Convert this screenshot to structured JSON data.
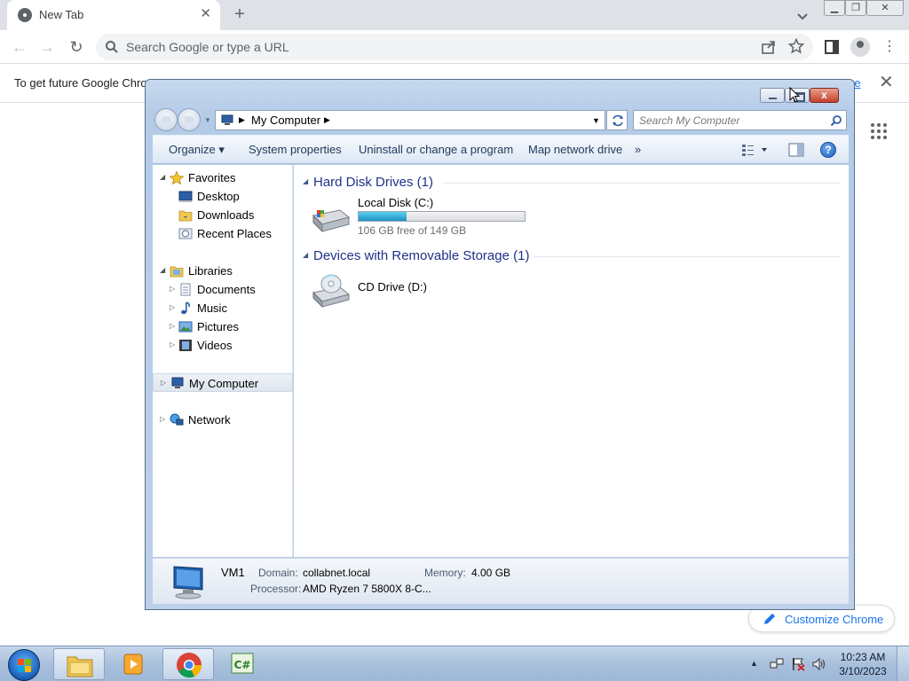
{
  "chrome": {
    "tab_title": "New Tab",
    "tab_close": "✕",
    "new_tab": "+",
    "omnibox_placeholder": "Search Google or type a URL",
    "infobar_text": "To get future Google Chrome updates",
    "infobar_link": "re",
    "infobar_close": "✕",
    "customize_label": "Customize Chrome",
    "accent_color": "#1a73e8"
  },
  "explorer": {
    "breadcrumb": "My Computer",
    "search_placeholder": "Search My Computer",
    "close_glyph": "x",
    "toolbar": {
      "organize": "Organize ▾",
      "system_properties": "System properties",
      "uninstall": "Uninstall or change a program",
      "map_drive": "Map network drive",
      "more": "»",
      "help": "?"
    },
    "nav": {
      "favorites": "Favorites",
      "desktop": "Desktop",
      "downloads": "Downloads",
      "recent_places": "Recent Places",
      "libraries": "Libraries",
      "documents": "Documents",
      "music": "Music",
      "pictures": "Pictures",
      "videos": "Videos",
      "my_computer": "My Computer",
      "network": "Network"
    },
    "groups": {
      "hard_disk": "Hard Disk Drives (1)",
      "removable": "Devices with Removable Storage (1)"
    },
    "drives": {
      "c_name": "Local Disk (C:)",
      "c_free": "106 GB free of 149 GB",
      "c_used_fraction": 0.29,
      "d_name": "CD Drive (D:)"
    },
    "details": {
      "name": "VM1",
      "domain_label": "Domain:",
      "domain_value": "collabnet.local",
      "memory_label": "Memory:",
      "memory_value": "4.00 GB",
      "processor_label": "Processor:",
      "processor_value": "AMD Ryzen 7 5800X 8-C..."
    }
  },
  "taskbar": {
    "time": "10:23 AM",
    "date": "3/10/2023"
  }
}
